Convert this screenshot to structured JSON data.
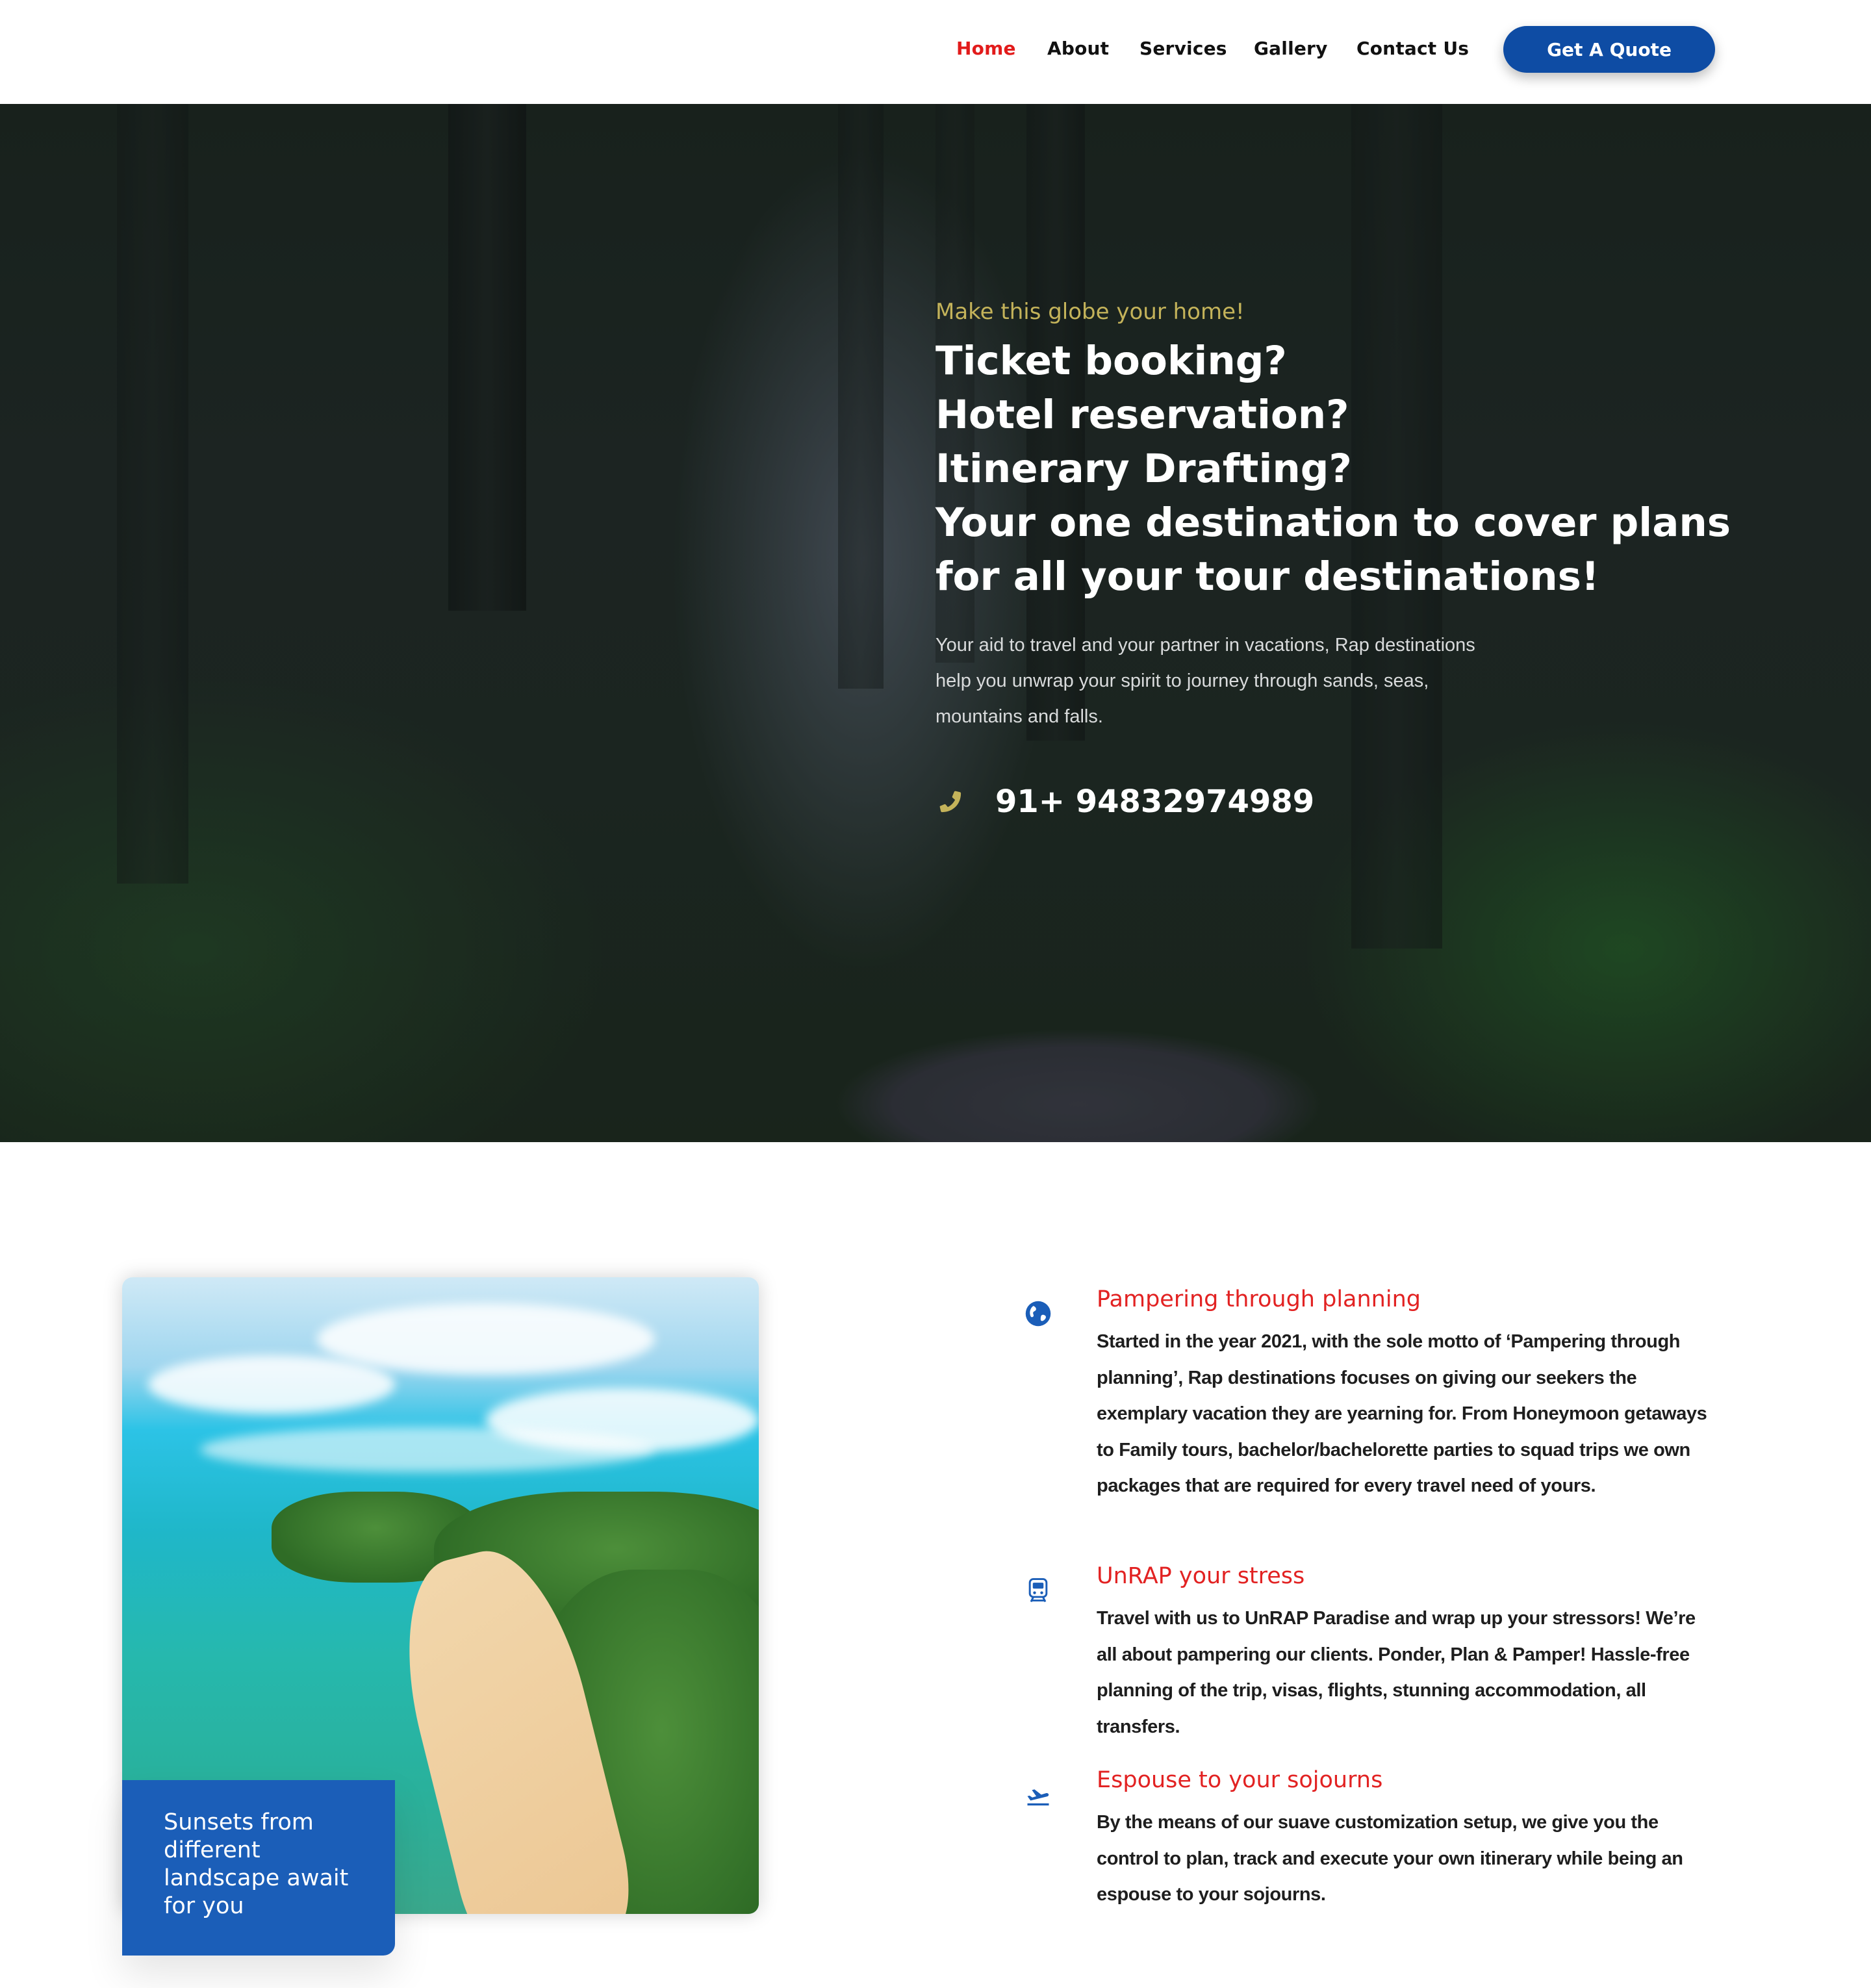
{
  "nav": {
    "items": [
      {
        "label": "Home",
        "active": true
      },
      {
        "label": "About",
        "active": false
      },
      {
        "label": "Services",
        "active": false
      },
      {
        "label": "Gallery",
        "active": false
      },
      {
        "label": "Contact Us",
        "active": false
      }
    ],
    "cta_label": "Get A Quote"
  },
  "hero": {
    "tagline": "Make this globe your home!",
    "headline_lines": [
      "Ticket booking?",
      "Hotel reservation?",
      "Itinerary Drafting?",
      "Your one destination to cover plans",
      "for all your tour destinations!"
    ],
    "description": "Your aid to travel and your partner in vacations, Rap destinations help you unwrap your spirit to journey through sands, seas, mountains and falls.",
    "phone_icon": "phone-icon",
    "phone": "91+ 94832974989"
  },
  "features": {
    "image_caption": "Sunsets from different landscape await for you",
    "items": [
      {
        "icon": "globe-icon",
        "title": "Pampering through planning",
        "body": "Started in the year 2021, with the sole motto of ‘Pampering through planning’, Rap destinations focuses on giving our seekers the exemplary vacation they are yearning for. From Honeymoon getaways to Family tours, bachelor/bachelorette parties to squad trips we own packages that are required for every travel need of yours."
      },
      {
        "icon": "train-icon",
        "title": "UnRAP your stress",
        "body": "Travel with us to UnRAP Paradise and wrap up your stressors! We’re all about pampering our clients. Ponder, Plan & Pamper! Hassle-free planning of the trip, visas, flights, stunning accommodation, all transfers."
      },
      {
        "icon": "plane-takeoff-icon",
        "title": "Espouse to your sojourns",
        "body": "By the means of our suave customization setup, we give you the control to plan, track and execute your own itinerary while being an espouse to your sojourns."
      }
    ]
  },
  "colors": {
    "accent_red": "#e21b1b",
    "brand_blue": "#0e4ca4",
    "tagline_gold": "#c4b35a"
  }
}
